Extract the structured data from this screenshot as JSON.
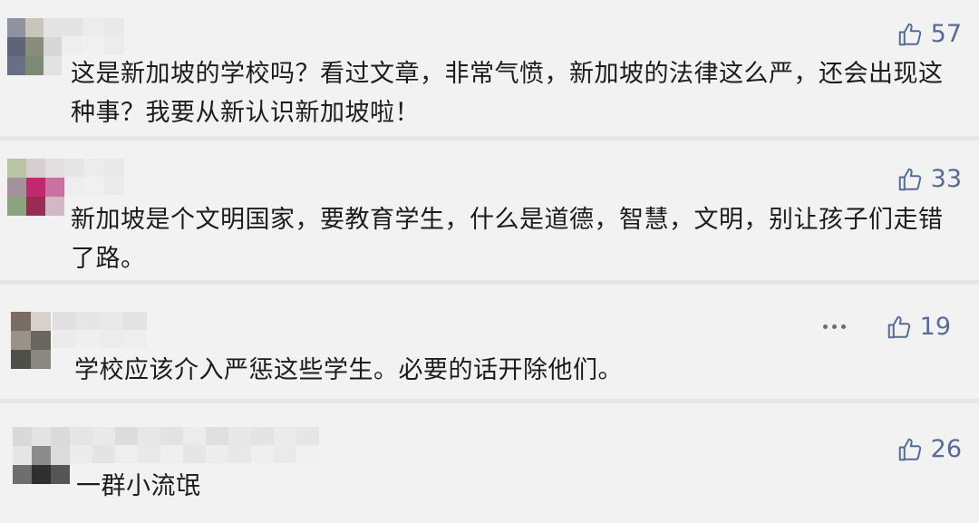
{
  "comments": [
    {
      "likes": "57",
      "text": "这是新加坡的学校吗？看过文章，非常气愤，新加坡的法律这么严，还会出现这种事？我要从新认识新加坡啦！"
    },
    {
      "likes": "33",
      "text": "新加坡是个文明国家，要教育学生，什么是道德，智慧，文明，别让孩子们走错了路。"
    },
    {
      "likes": "19",
      "text": "学校应该介入严惩这些学生。必要的话开除他们。"
    },
    {
      "likes": "26",
      "text": "一群小流氓"
    }
  ],
  "colors": {
    "accent": "#576b95",
    "background": "#f2f2f2",
    "divider": "#e6e6e6",
    "text": "#1c1c1c"
  },
  "icons": {
    "like": "thumbs-up-icon",
    "more": "more-dots-icon",
    "avatar": "pixelated-avatar",
    "nickname": "pixelated-nickname"
  }
}
